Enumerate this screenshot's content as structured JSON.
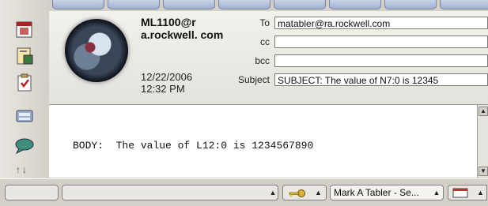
{
  "message": {
    "sender": "ML1100@r a.rockwell. com",
    "date": "12/22/2006",
    "time": "12:32 PM"
  },
  "fields": {
    "to_label": "To",
    "to_value": "matabler@ra.rockwell.com",
    "cc_label": "cc",
    "cc_value": "",
    "bcc_label": "bcc",
    "bcc_value": "",
    "subject_label": "Subject",
    "subject_value": "SUBJECT:  The value of N7:0 is 12345"
  },
  "body": {
    "text": "BODY:  The value of L12:0 is 1234567890"
  },
  "rail": {
    "icons": [
      "calendar-icon",
      "notes-icon",
      "todo-icon",
      "contacts-icon",
      "chat-icon"
    ],
    "arrows": "↑↓"
  },
  "statusbar": {
    "user": "Mark A Tabler - Se...",
    "dropdown_arrow": "▲",
    "key_icon": "key-icon",
    "envelope_icon": "envelope-icon"
  },
  "colors": {
    "background": "#d4d0c8",
    "tab_blue": "#9fb0d0"
  }
}
